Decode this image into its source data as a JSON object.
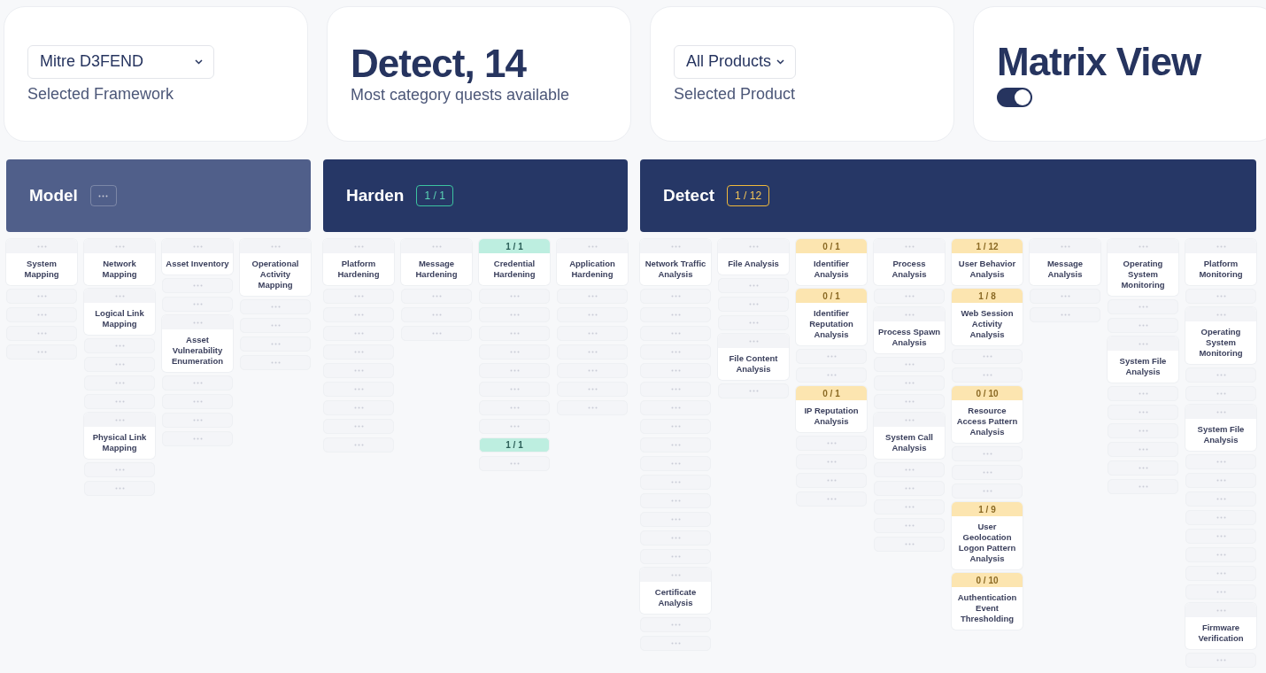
{
  "top": {
    "framework": {
      "value": "Mitre D3FEND",
      "label": "Selected Framework"
    },
    "highlight": {
      "value": "Detect, 14",
      "label": "Most category quests available"
    },
    "product": {
      "value": "All Products",
      "label": "Selected Product"
    },
    "view": {
      "title": "Matrix View",
      "on": true
    }
  },
  "tactics": [
    {
      "name": "Model",
      "dimmed": true,
      "columns": [
        [
          {
            "kind": "technique",
            "name": "System Mapping"
          },
          {
            "kind": "slot"
          },
          {
            "kind": "slot"
          },
          {
            "kind": "slot"
          },
          {
            "kind": "slot"
          }
        ],
        [
          {
            "kind": "technique",
            "name": "Network Mapping"
          },
          {
            "kind": "technique",
            "name": "Logical Link Mapping"
          },
          {
            "kind": "slot"
          },
          {
            "kind": "slot"
          },
          {
            "kind": "slot"
          },
          {
            "kind": "slot"
          },
          {
            "kind": "technique",
            "name": "Physical Link Mapping"
          },
          {
            "kind": "slot"
          },
          {
            "kind": "slot"
          }
        ],
        [
          {
            "kind": "technique",
            "name": "Asset Inventory"
          },
          {
            "kind": "slot"
          },
          {
            "kind": "slot"
          },
          {
            "kind": "technique",
            "name": "Asset Vulnerability Enumeration"
          },
          {
            "kind": "slot"
          },
          {
            "kind": "slot"
          },
          {
            "kind": "slot"
          },
          {
            "kind": "slot"
          }
        ],
        [
          {
            "kind": "technique",
            "name": "Operational Activity Mapping"
          },
          {
            "kind": "slot"
          },
          {
            "kind": "slot"
          },
          {
            "kind": "slot"
          },
          {
            "kind": "slot"
          }
        ]
      ]
    },
    {
      "name": "Harden",
      "dimmed": false,
      "count": "1 / 1",
      "complete": true,
      "columns": [
        [
          {
            "kind": "technique",
            "name": "Platform Hardening"
          },
          {
            "kind": "slot"
          },
          {
            "kind": "slot"
          },
          {
            "kind": "slot"
          },
          {
            "kind": "slot"
          },
          {
            "kind": "slot"
          },
          {
            "kind": "slot"
          },
          {
            "kind": "slot"
          },
          {
            "kind": "slot"
          },
          {
            "kind": "slot"
          }
        ],
        [
          {
            "kind": "technique",
            "name": "Message Hardening"
          },
          {
            "kind": "slot"
          },
          {
            "kind": "slot"
          },
          {
            "kind": "slot"
          }
        ],
        [
          {
            "kind": "technique",
            "name": "Credential Hardening",
            "count": "1 / 1",
            "complete": true
          },
          {
            "kind": "slot"
          },
          {
            "kind": "slot"
          },
          {
            "kind": "slot"
          },
          {
            "kind": "slot"
          },
          {
            "kind": "slot"
          },
          {
            "kind": "slot"
          },
          {
            "kind": "slot"
          },
          {
            "kind": "slot"
          },
          {
            "kind": "slot",
            "count": "1 / 1",
            "complete": true
          },
          {
            "kind": "slot"
          }
        ],
        [
          {
            "kind": "technique",
            "name": "Application Hardening"
          },
          {
            "kind": "slot"
          },
          {
            "kind": "slot"
          },
          {
            "kind": "slot"
          },
          {
            "kind": "slot"
          },
          {
            "kind": "slot"
          },
          {
            "kind": "slot"
          },
          {
            "kind": "slot"
          }
        ]
      ]
    },
    {
      "name": "Detect",
      "dimmed": false,
      "count": "1 / 12",
      "complete": false,
      "columns": [
        [
          {
            "kind": "technique",
            "name": "Network Traffic Analysis"
          },
          {
            "kind": "slot"
          },
          {
            "kind": "slot"
          },
          {
            "kind": "slot"
          },
          {
            "kind": "slot"
          },
          {
            "kind": "slot"
          },
          {
            "kind": "slot"
          },
          {
            "kind": "slot"
          },
          {
            "kind": "slot"
          },
          {
            "kind": "slot"
          },
          {
            "kind": "slot"
          },
          {
            "kind": "slot"
          },
          {
            "kind": "slot"
          },
          {
            "kind": "slot"
          },
          {
            "kind": "slot"
          },
          {
            "kind": "slot"
          },
          {
            "kind": "technique",
            "name": "Certificate Analysis"
          },
          {
            "kind": "slot"
          },
          {
            "kind": "slot"
          }
        ],
        [
          {
            "kind": "technique",
            "name": "File Analysis"
          },
          {
            "kind": "slot"
          },
          {
            "kind": "slot"
          },
          {
            "kind": "slot"
          },
          {
            "kind": "technique",
            "name": "File Content Analysis"
          },
          {
            "kind": "slot"
          }
        ],
        [
          {
            "kind": "technique",
            "name": "Identifier Analysis",
            "count": "0 / 1",
            "complete": false
          },
          {
            "kind": "technique",
            "name": "Identifier Reputation Analysis",
            "count": "0 / 1",
            "complete": false
          },
          {
            "kind": "slot"
          },
          {
            "kind": "slot"
          },
          {
            "kind": "technique",
            "name": "IP Reputation Analysis",
            "count": "0 / 1",
            "complete": false
          },
          {
            "kind": "slot"
          },
          {
            "kind": "slot"
          },
          {
            "kind": "slot"
          },
          {
            "kind": "slot"
          }
        ],
        [
          {
            "kind": "technique",
            "name": "Process Analysis"
          },
          {
            "kind": "slot"
          },
          {
            "kind": "technique",
            "name": "Process Spawn Analysis"
          },
          {
            "kind": "slot"
          },
          {
            "kind": "slot"
          },
          {
            "kind": "slot"
          },
          {
            "kind": "technique",
            "name": "System Call Analysis"
          },
          {
            "kind": "slot"
          },
          {
            "kind": "slot"
          },
          {
            "kind": "slot"
          },
          {
            "kind": "slot"
          },
          {
            "kind": "slot"
          }
        ],
        [
          {
            "kind": "technique",
            "name": "User Behavior Analysis",
            "count": "1 / 12",
            "complete": false
          },
          {
            "kind": "technique",
            "name": "Web Session Activity Analysis",
            "count": "1 / 8",
            "complete": false
          },
          {
            "kind": "slot"
          },
          {
            "kind": "slot"
          },
          {
            "kind": "technique",
            "name": "Resource Access Pattern Analysis",
            "count": "0 / 10",
            "complete": false
          },
          {
            "kind": "slot"
          },
          {
            "kind": "slot"
          },
          {
            "kind": "slot"
          },
          {
            "kind": "technique",
            "name": "User Geolocation Logon Pattern Analysis",
            "count": "1 / 9",
            "complete": false
          },
          {
            "kind": "technique",
            "name": "Authentication Event Thresholding",
            "count": "0 / 10",
            "complete": false
          }
        ],
        [
          {
            "kind": "technique",
            "name": "Message Analysis"
          },
          {
            "kind": "slot"
          },
          {
            "kind": "slot"
          }
        ],
        [
          {
            "kind": "technique",
            "name": "Operating System Monitoring"
          },
          {
            "kind": "slot"
          },
          {
            "kind": "slot"
          },
          {
            "kind": "technique",
            "name": "System File Analysis"
          },
          {
            "kind": "slot"
          },
          {
            "kind": "slot"
          },
          {
            "kind": "slot"
          },
          {
            "kind": "slot"
          },
          {
            "kind": "slot"
          },
          {
            "kind": "slot"
          }
        ],
        [
          {
            "kind": "technique",
            "name": "Platform Monitoring"
          },
          {
            "kind": "slot"
          },
          {
            "kind": "technique",
            "name": "Operating System Monitoring"
          },
          {
            "kind": "slot"
          },
          {
            "kind": "slot"
          },
          {
            "kind": "technique",
            "name": "System File Analysis"
          },
          {
            "kind": "slot"
          },
          {
            "kind": "slot"
          },
          {
            "kind": "slot"
          },
          {
            "kind": "slot"
          },
          {
            "kind": "slot"
          },
          {
            "kind": "slot"
          },
          {
            "kind": "slot"
          },
          {
            "kind": "slot"
          },
          {
            "kind": "technique",
            "name": "Firmware Verification"
          },
          {
            "kind": "slot"
          }
        ]
      ]
    }
  ]
}
